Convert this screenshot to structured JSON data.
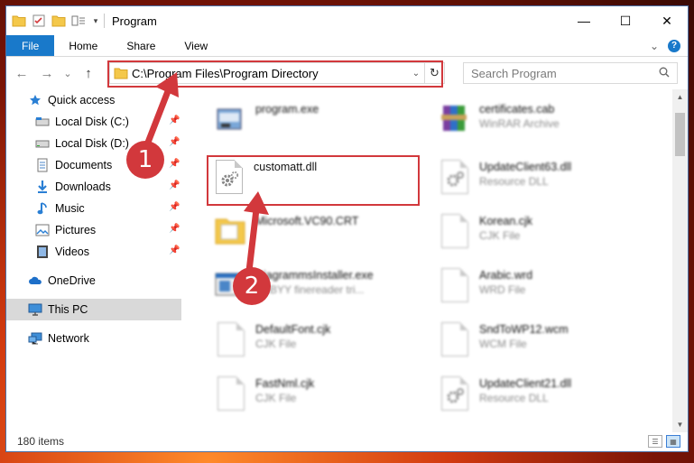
{
  "window": {
    "title": "Program",
    "controls": {
      "minimize": "—",
      "maximize": "☐",
      "close": "✕"
    }
  },
  "ribbon": {
    "tabs": [
      "File",
      "Home",
      "Share",
      "View"
    ],
    "expand_glyph": "⌄",
    "help_label": "?"
  },
  "navigation": {
    "back_glyph": "←",
    "forward_glyph": "→",
    "recent_glyph": "⌄",
    "up_glyph": "↑",
    "address": "C:\\Program Files\\Program Directory",
    "search_placeholder": "Search Program"
  },
  "sidebar": {
    "items": [
      {
        "label": "Quick access",
        "icon": "star-icon",
        "pinned": false
      },
      {
        "label": "Local Disk (C:)",
        "icon": "drive-icon",
        "pinned": true
      },
      {
        "label": "Local Disk (D:)",
        "icon": "drive-icon",
        "pinned": true
      },
      {
        "label": "Documents",
        "icon": "documents-icon",
        "pinned": true
      },
      {
        "label": "Downloads",
        "icon": "download-icon",
        "pinned": true
      },
      {
        "label": "Music",
        "icon": "music-icon",
        "pinned": true
      },
      {
        "label": "Pictures",
        "icon": "pictures-icon",
        "pinned": true
      },
      {
        "label": "Videos",
        "icon": "videos-icon",
        "pinned": true
      },
      {
        "label": "OneDrive",
        "icon": "cloud-icon",
        "pinned": false
      },
      {
        "label": "This PC",
        "icon": "computer-icon",
        "pinned": false,
        "selected": true
      },
      {
        "label": "Network",
        "icon": "network-icon",
        "pinned": false
      }
    ]
  },
  "files": {
    "left": [
      {
        "name": "program.exe",
        "type": "",
        "icon": "exe-icon",
        "blurred": true
      },
      {
        "name": "customatt.dll",
        "type": "",
        "icon": "dll-icon",
        "blurred": false,
        "highlighted": true
      },
      {
        "name": "Microsoft.VC90.CRT",
        "type": "",
        "icon": "folder-icon",
        "blurred": true
      },
      {
        "name": "DiagrammsInstaller.exe",
        "type": "ABBYY finereader tri...",
        "icon": "exe-icon",
        "blurred": true
      },
      {
        "name": "DefaultFont.cjk",
        "type": "CJK File",
        "icon": "file-icon",
        "blurred": true
      },
      {
        "name": "FastNml.cjk",
        "type": "CJK File",
        "icon": "file-icon",
        "blurred": true
      }
    ],
    "right": [
      {
        "name": "certificates.cab",
        "type": "WinRAR Archive",
        "icon": "archive-icon",
        "blurred": true
      },
      {
        "name": "UpdateClient63.dll",
        "type": "Resource DLL",
        "icon": "dll-icon",
        "blurred": true
      },
      {
        "name": "Korean.cjk",
        "type": "CJK File",
        "icon": "file-icon",
        "blurred": true
      },
      {
        "name": "Arabic.wrd",
        "type": "WRD File",
        "icon": "file-icon",
        "blurred": true
      },
      {
        "name": "SndToWP12.wcm",
        "type": "WCM File",
        "icon": "file-icon",
        "blurred": true
      },
      {
        "name": "UpdateClient21.dll",
        "type": "Resource DLL",
        "icon": "dll-icon",
        "blurred": true
      }
    ]
  },
  "status": {
    "item_count": "180 items"
  },
  "annotations": [
    {
      "number": "1",
      "target": "address-bar"
    },
    {
      "number": "2",
      "target": "customatt.dll"
    }
  ],
  "colors": {
    "accent": "#1979ca",
    "highlight_red": "#d2383c",
    "selected_nav": "#d9d9d9"
  }
}
